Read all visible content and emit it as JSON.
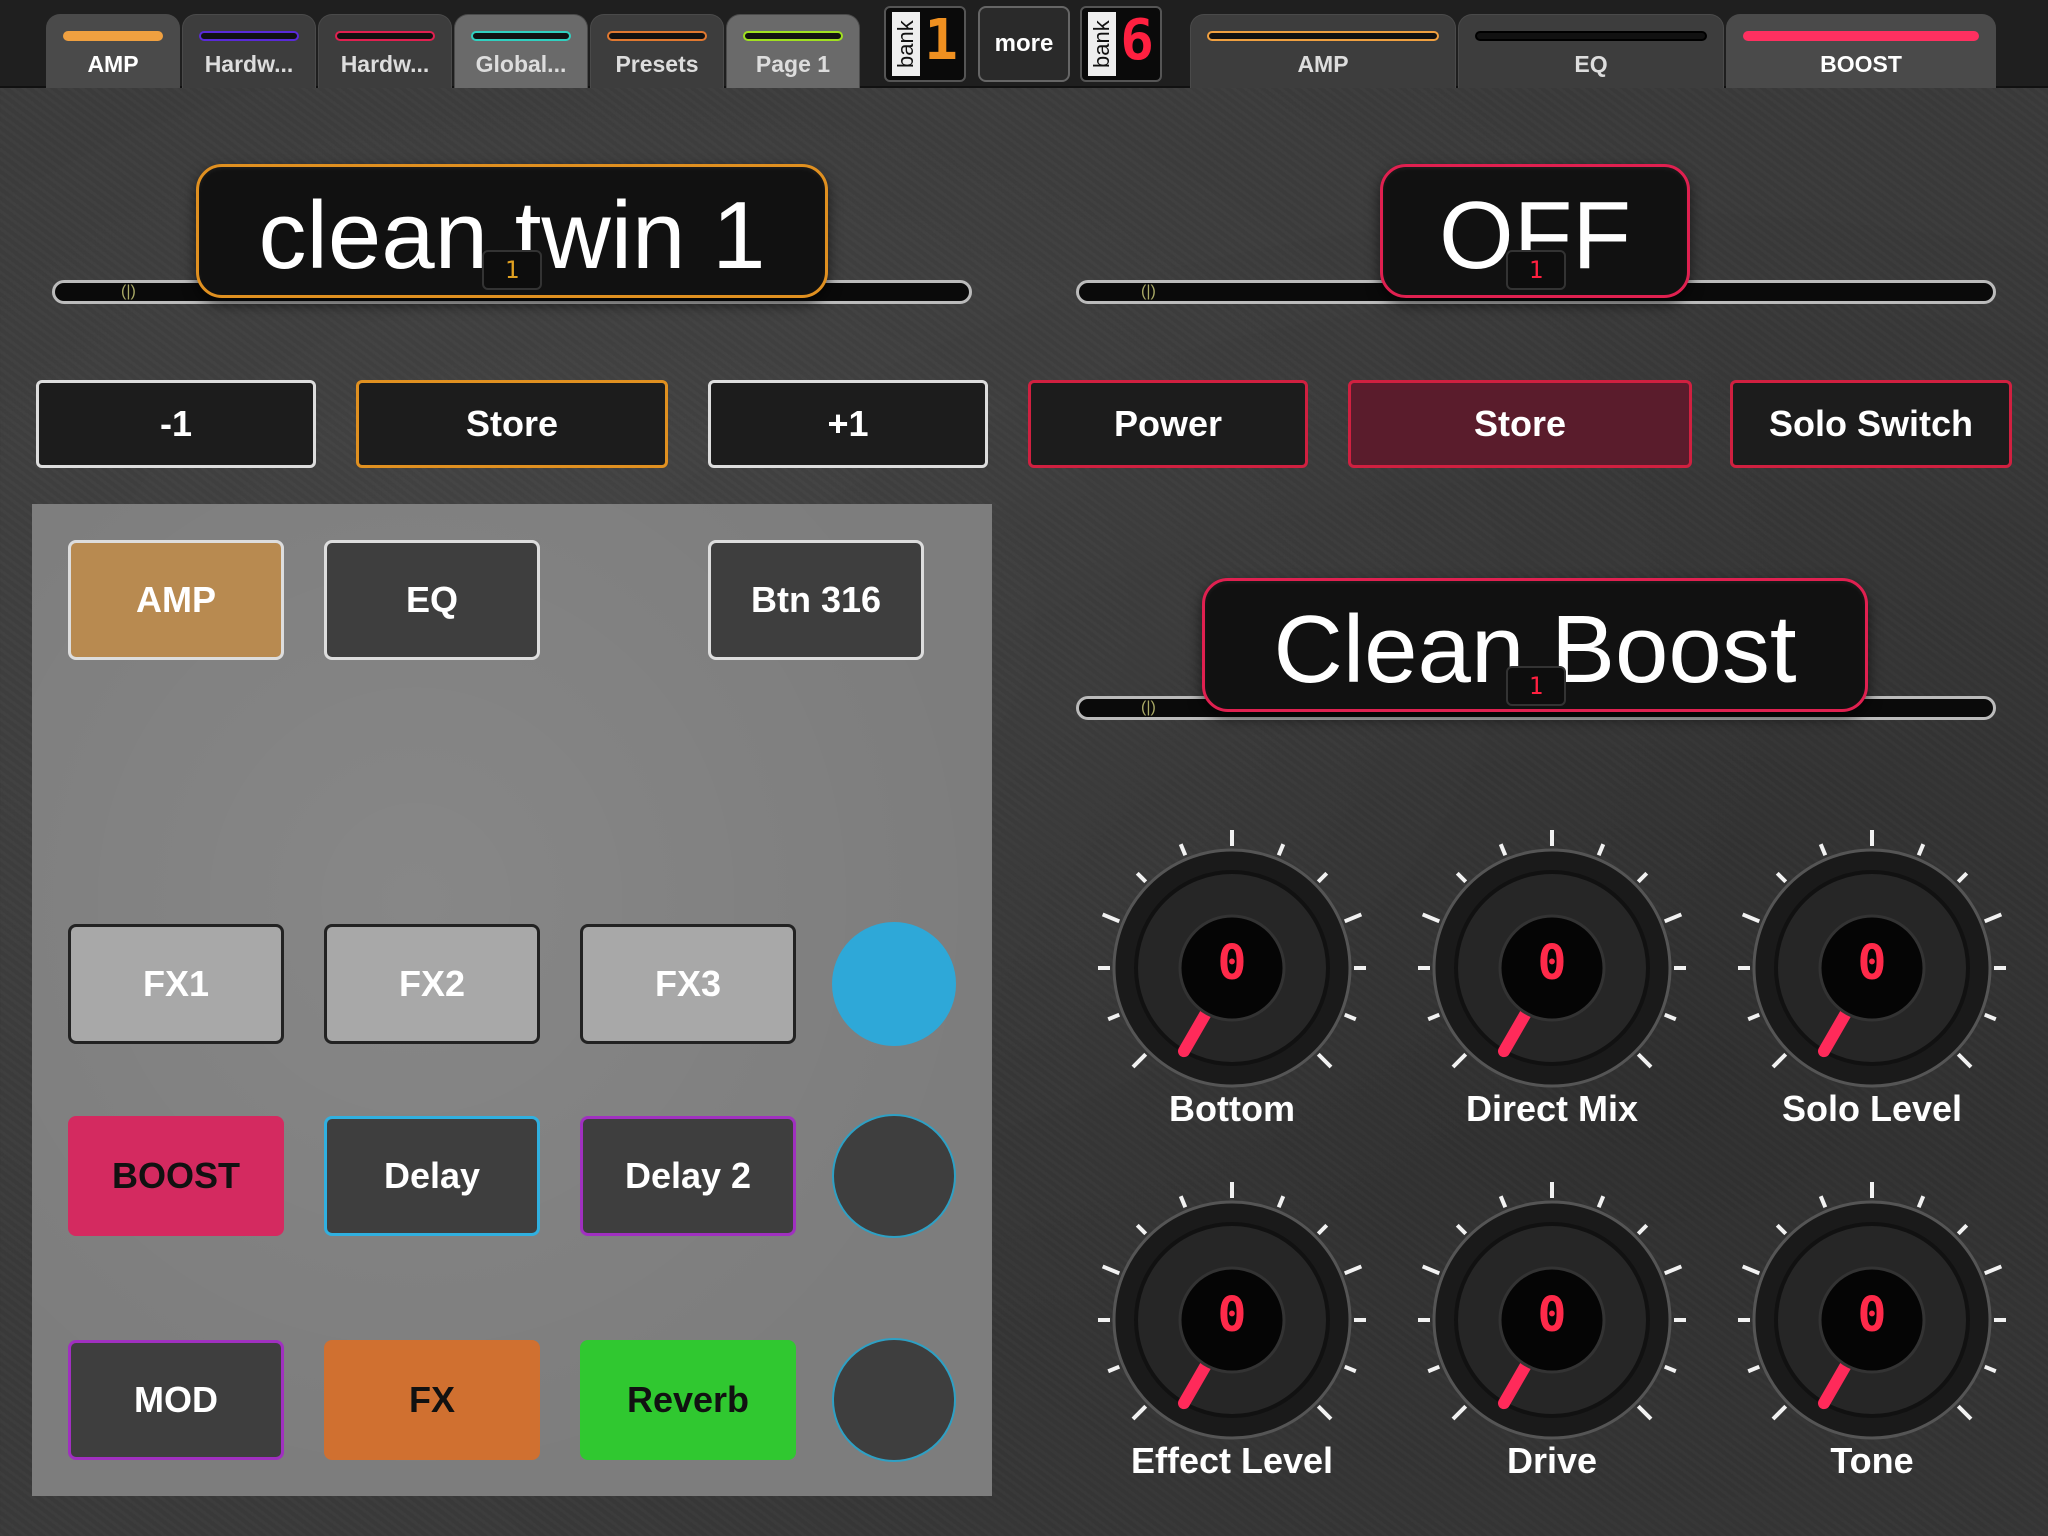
{
  "topbar": {
    "tabs": [
      {
        "label": "AMP",
        "color": "#f0a040",
        "active": true
      },
      {
        "label": "Hardw...",
        "color": "#5a2ad8",
        "active": false
      },
      {
        "label": "Hardw...",
        "color": "#e02050",
        "active": false
      },
      {
        "label": "Global...",
        "color": "#30d0c0",
        "active": false
      },
      {
        "label": "Presets",
        "color": "#e07830",
        "active": false
      },
      {
        "label": "Page 1",
        "color": "#a0e020",
        "active": false
      }
    ],
    "bank_left": {
      "word": "bank",
      "digit": "1",
      "color": "#f09020"
    },
    "more_label": "more",
    "bank_right": {
      "word": "bank",
      "digit": "6",
      "color": "#ff2040"
    },
    "right_tabs": [
      {
        "label": "AMP",
        "color": "#f0a040",
        "active": false
      },
      {
        "label": "EQ",
        "color": "#111111",
        "active": false
      },
      {
        "label": "BOOST",
        "color": "#ff3060",
        "active": true
      }
    ]
  },
  "amp_display": {
    "text": "clean twin 1",
    "led": "1",
    "color": "#e09020"
  },
  "power_display": {
    "text": "OFF",
    "led": "1",
    "color": "#e02050"
  },
  "boost_display": {
    "text": "Clean Boost",
    "led": "1",
    "color": "#e02050"
  },
  "left_buttons": [
    {
      "label": "-1",
      "color": "#dddddd"
    },
    {
      "label": "Store",
      "color": "#e09020"
    },
    {
      "label": "+1",
      "color": "#dddddd"
    }
  ],
  "right_buttons": [
    {
      "label": "Power",
      "color": "#d02040"
    },
    {
      "label": "Store",
      "color": "#d02040"
    },
    {
      "label": "Solo Switch",
      "color": "#d02040"
    }
  ],
  "panel": {
    "row1": [
      {
        "label": "AMP",
        "bg": "#b88a50",
        "border": "#dddddd",
        "fc": "#ffffff"
      },
      {
        "label": "EQ",
        "bg": "#3e3e3e",
        "border": "#dddddd",
        "fc": "#ffffff"
      },
      {
        "label": "Btn 316",
        "bg": "#3e3e3e",
        "border": "#dddddd",
        "fc": "#ffffff"
      }
    ],
    "row2": [
      {
        "label": "FX1",
        "bg": "#a8a8a8",
        "border": "#222222",
        "fc": "#ffffff"
      },
      {
        "label": "FX2",
        "bg": "#a8a8a8",
        "border": "#222222",
        "fc": "#ffffff"
      },
      {
        "label": "FX3",
        "bg": "#a8a8a8",
        "border": "#222222",
        "fc": "#ffffff"
      }
    ],
    "row3": [
      {
        "label": "BOOST",
        "bg": "#d42a60",
        "border": "#d42a60",
        "fc": "#111111"
      },
      {
        "label": "Delay",
        "bg": "#3e3e3e",
        "border": "#30b0e0",
        "fc": "#ffffff"
      },
      {
        "label": "Delay 2",
        "bg": "#3e3e3e",
        "border": "#a030c0",
        "fc": "#ffffff"
      }
    ],
    "row4": [
      {
        "label": "MOD",
        "bg": "#3e3e3e",
        "border": "#a030c0",
        "fc": "#ffffff"
      },
      {
        "label": "FX",
        "bg": "#d07030",
        "border": "#d07030",
        "fc": "#111111"
      },
      {
        "label": "Reverb",
        "bg": "#30c830",
        "border": "#30c830",
        "fc": "#111111"
      }
    ],
    "circles": [
      {
        "state": "on",
        "color": "#2ea8d8"
      },
      {
        "state": "off",
        "color": "#3e3e3e"
      },
      {
        "state": "off",
        "color": "#3e3e3e"
      }
    ]
  },
  "knobs": [
    {
      "label": "Bottom",
      "value": "0"
    },
    {
      "label": "Direct Mix",
      "value": "0"
    },
    {
      "label": "Solo Level",
      "value": "0"
    },
    {
      "label": "Effect Level",
      "value": "0"
    },
    {
      "label": "Drive",
      "value": "0"
    },
    {
      "label": "Tone",
      "value": "0"
    }
  ]
}
